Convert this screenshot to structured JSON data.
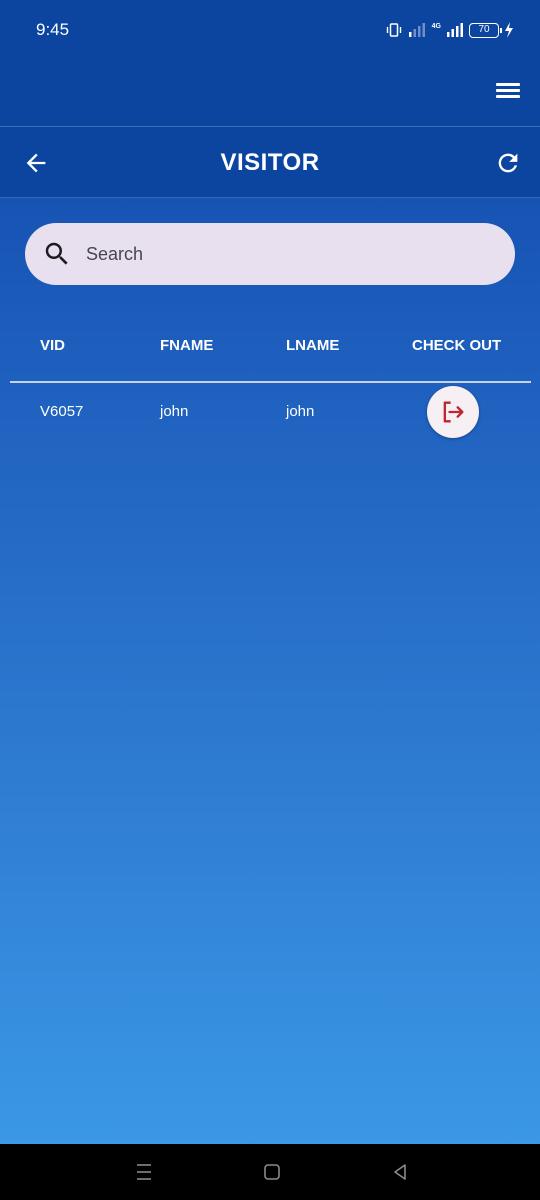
{
  "status_bar": {
    "time": "9:45",
    "battery": "70",
    "network": "4G"
  },
  "header": {
    "title": "VISITOR",
    "icons": [
      "hamburger-menu-icon",
      "arrow-left-icon",
      "refresh-icon"
    ]
  },
  "search": {
    "placeholder": "Search",
    "value": ""
  },
  "table": {
    "columns": [
      "VID",
      "FNAME",
      "LNAME",
      "CHECK OUT"
    ],
    "rows": [
      {
        "vid": "V6057",
        "fname": "john",
        "lname": "john",
        "action_icon": "logout-icon"
      }
    ]
  },
  "colors": {
    "header_bg": "#0c45a0",
    "gradient_bottom": "#3d9ce9",
    "search_bg": "#e8e0ee",
    "checkout_icon": "#c0262d"
  }
}
